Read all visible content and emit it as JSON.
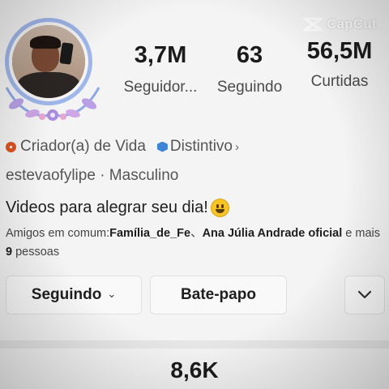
{
  "watermark": {
    "text": "CapCut",
    "icon": "capcut-logo-icon"
  },
  "profile": {
    "avatar": "avatar-photo",
    "stats": [
      {
        "value": "3,7M",
        "label": "Seguidor..."
      },
      {
        "value": "63",
        "label": "Seguindo"
      },
      {
        "value": "56,5M",
        "label": "Curtidas"
      }
    ],
    "category": {
      "text": "Criador(a) de Vida",
      "icon": "creator-icon"
    },
    "badge": {
      "text": "Distintivo",
      "icon": "verified-badge-icon"
    },
    "handle": "estevaofylipe",
    "separator": "·",
    "gender": "Masculino",
    "bio": "Videos para alegrar seu dia!",
    "mutual": {
      "prefix": "Amigos em comum:",
      "friend1": "Família_de_Fe",
      "separator": "、",
      "friend2": "Ana Júlia Andrade oficial",
      "middle": " e mais ",
      "count": "9",
      "suffix": " pessoas"
    }
  },
  "actions": {
    "following_label": "Seguindo",
    "chat_label": "Bate-papo"
  },
  "bottom": {
    "count": "8,6K"
  }
}
